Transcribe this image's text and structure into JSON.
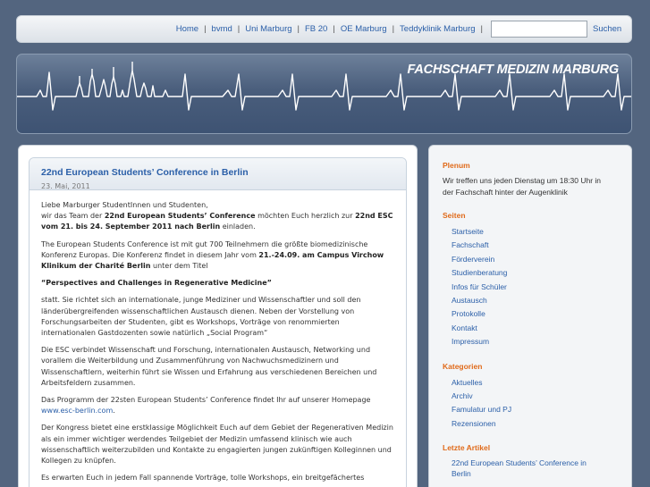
{
  "nav": {
    "links": [
      "Home",
      "bvmd",
      "Uni Marburg",
      "FB 20",
      "OE Marburg",
      "Teddyklinik Marburg"
    ],
    "separator": "|",
    "search_button": "Suchen",
    "search_value": ""
  },
  "banner": {
    "title": "FACHSCHAFT MEDIZIN MARBURG"
  },
  "post": {
    "title": "22nd European Students’ Conference in Berlin",
    "date": "23. Mai, 2011",
    "p1_a": "Liebe Marburger StudentInnen und Studenten,",
    "p1_b": "wir das Team der ",
    "p1_b_bold": "22nd European Students’ Conference",
    "p1_c": " möchten Euch herzlich zur ",
    "p1_c_bold": "22nd ESC vom 21. bis 24. September 2011 nach Berlin",
    "p1_d": " einladen.",
    "p2_a": "The European Students Conference ist mit gut 700 Teilnehmern die größte biomedizinische Konferenz Europas. Die Konferenz findet in diesem Jahr vom ",
    "p2_bold": "21.-24.09. am Campus Virchow Klinikum der Charité Berlin",
    "p2_b": " unter dem Titel",
    "p3": "“Perspectives and Challenges in Regenerative Medicine”",
    "p4": "statt. Sie richtet sich an internationale, junge Mediziner und Wissenschaftler und soll den länderübergreifenden wissenschaftlichen Austausch dienen. Neben der Vorstellung von Forschungsarbeiten der Studenten, gibt es Workshops, Vorträge von renommierten internationalen Gastdozenten sowie natürlich „Social Program“",
    "p5": "Die ESC verbindet Wissenschaft und Forschung, internationalen Austausch, Networking und vorallem die Weiterbildung und Zusammenführung von Nachwuchsmedizinern und Wissenschaftlern, weiterhin führt sie Wissen und Erfahrung aus verschiedenen Bereichen und Arbeitsfeldern zusammen.",
    "p6_a": "Das Programm der 22sten European Students’ Conference findet Ihr auf unserer Homepage",
    "p6_link": "www.esc-berlin.com",
    "p6_b": ".",
    "p7": "Der Kongress bietet eine erstklassige Möglichkeit Euch auf dem Gebiet der Regenerativen Medizin als ein immer wichtiger werdendes Teilgebiet der Medizin umfassend klinisch wie auch wissenschaftlich weiterzubilden und Kontakte zu engagierten jungen zukünftigen Kolleginnen und Kollegen zu knüpfen.",
    "p8": "Es erwarten Euch in jedem Fall spannende Vorträge, tolle Workshops, ein breitgefächertes"
  },
  "sidebar": {
    "plenum_heading": "Plenum",
    "plenum_text": "Wir treffen uns jeden Dienstag um 18:30 Uhr in der Fachschaft hinter der Augenklinik",
    "seiten_heading": "Seiten",
    "seiten": [
      "Startseite",
      "Fachschaft",
      "Förderverein",
      "Studienberatung",
      "Infos für Schüler",
      "Austausch",
      "Protokolle",
      "Kontakt",
      "Impressum"
    ],
    "kategorien_heading": "Kategorien",
    "kategorien": [
      "Aktuelles",
      "Archiv",
      "Famulatur und PJ",
      "Rezensionen"
    ],
    "letzte_heading": "Letzte Artikel",
    "letzte": [
      "22nd European Students’ Conference in Berlin"
    ]
  },
  "colors": {
    "background": "#53657f",
    "link": "#2b5fa8",
    "sidebar_heading": "#e06a1a"
  }
}
